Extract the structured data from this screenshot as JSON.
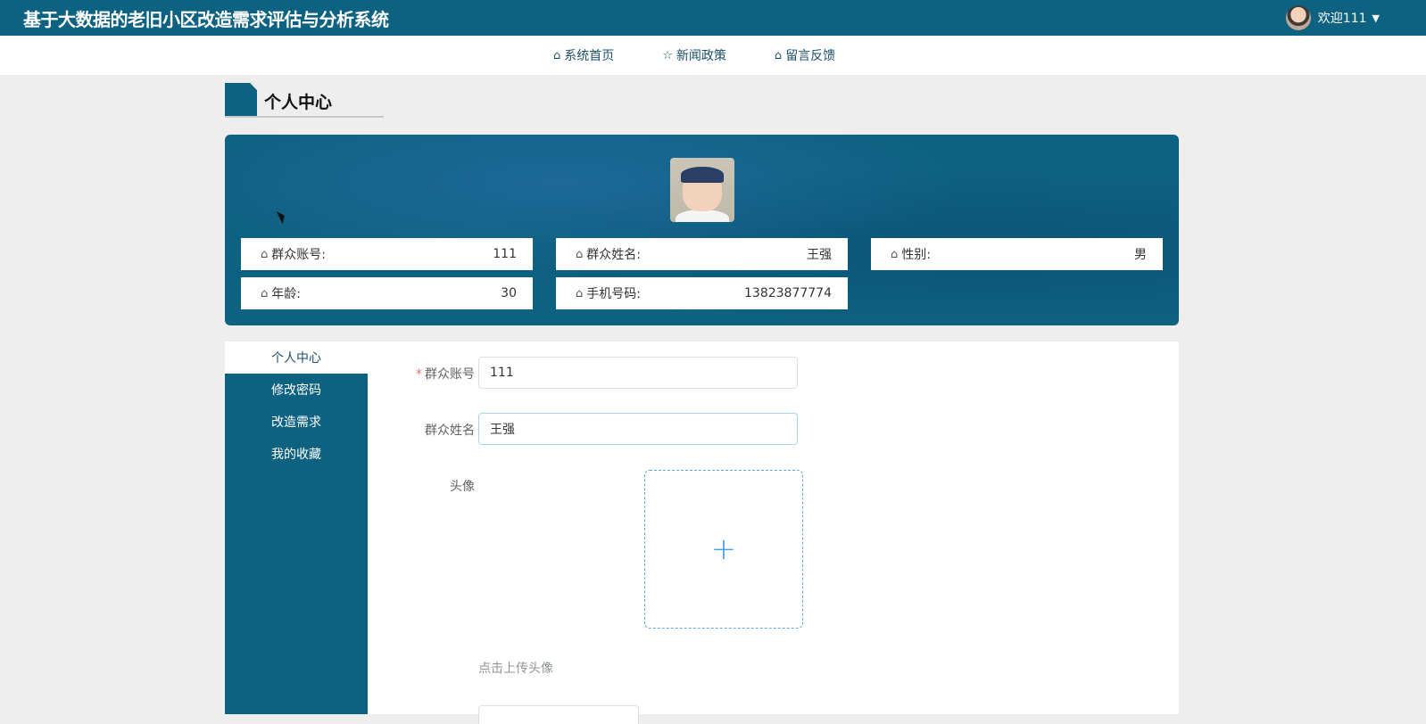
{
  "header": {
    "app_title": "基于大数据的老旧小区改造需求评估与分析系统",
    "welcome": "欢迎111",
    "caret": "▼"
  },
  "nav": {
    "items": [
      {
        "icon": "home-icon",
        "label": "系统首页"
      },
      {
        "icon": "star-icon",
        "label": "新闻政策"
      },
      {
        "icon": "bag-icon",
        "label": "留言反馈"
      }
    ]
  },
  "section": {
    "title": "个人中心"
  },
  "profile": {
    "fields": [
      {
        "label": "群众账号:",
        "value": "111"
      },
      {
        "label": "群众姓名:",
        "value": "王强"
      },
      {
        "label": "性别:",
        "value": "男"
      },
      {
        "label": "年龄:",
        "value": "30"
      },
      {
        "label": "手机号码:",
        "value": "13823877774"
      }
    ]
  },
  "side_menu": {
    "items": [
      {
        "label": "个人中心",
        "active": true
      },
      {
        "label": "修改密码",
        "active": false
      },
      {
        "label": "改造需求",
        "active": false
      },
      {
        "label": "我的收藏",
        "active": false
      }
    ]
  },
  "form": {
    "account_label": "群众账号",
    "account_required_mark": "*",
    "account_value": "111",
    "name_label": "群众姓名",
    "name_value": "王强",
    "avatar_label": "头像",
    "upload_plus": "+",
    "upload_hint": "点击上传头像"
  },
  "colors": {
    "primary": "#0e6281",
    "page_bg": "#efeeef",
    "required": "#f56c6c",
    "upload_accent": "#409eff"
  }
}
